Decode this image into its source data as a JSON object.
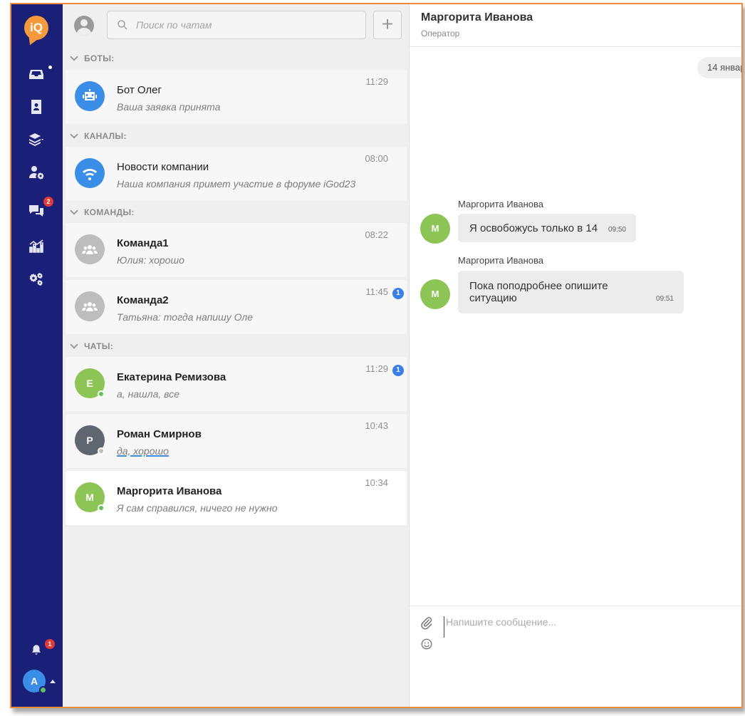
{
  "app": {
    "logo_text": "iQ"
  },
  "rail": {
    "messages_badge": "2",
    "notifications_badge": "1",
    "user_initial": "А"
  },
  "search": {
    "placeholder": "Поиск по чатам"
  },
  "add_label": "+",
  "sections": {
    "bots": "БОТЫ:",
    "channels": "КАНАЛЫ:",
    "teams": "КОМАНДЫ:",
    "chats": "ЧАТЫ:"
  },
  "chats": [
    {
      "name": "Бот Олег",
      "preview": "Ваша заявка принята",
      "time": "11:29",
      "avatar_icon": "robot-icon",
      "avatar_color": "#3a8ee8"
    },
    {
      "name": "Новости компании",
      "preview": "Наша компания примет участие в форуме iGod23",
      "time": "08:00",
      "avatar_icon": "wifi-icon",
      "avatar_color": "#3a8ee8"
    },
    {
      "name": "Команда1",
      "preview": "Юлия: хорошо",
      "time": "08:22",
      "avatar_icon": "team-icon",
      "avatar_color": "#bdbdbd"
    },
    {
      "name": "Команда2",
      "preview": "Татьяна: тогда напишу Оле",
      "time": "11:45",
      "unread": "1",
      "avatar_icon": "team-icon",
      "avatar_color": "#bdbdbd"
    },
    {
      "name": "Екатерина Ремизова",
      "preview": "а, нашла, все",
      "time": "11:29",
      "unread": "1",
      "initial": "Е",
      "avatar_color": "#8cc455",
      "status_color": "#5cc05c"
    },
    {
      "name": "Роман Смирнов",
      "preview": "да, хорошо",
      "time": "10:43",
      "initial": "Р",
      "avatar_color": "#5f6670",
      "status_color": "#bdbdbd"
    },
    {
      "name": "Маргорита Иванова",
      "preview": "Я сам справился, ничего не нужно",
      "time": "10:34",
      "initial": "М",
      "avatar_color": "#8cc455",
      "status_color": "#5cc05c"
    }
  ],
  "conversation": {
    "title": "Маргорита Иванова",
    "subtitle": "Оператор",
    "date_label": "14 январ",
    "messages": [
      {
        "author": "Маргорита Иванова",
        "initial": "М",
        "text": "Я освобожусь только в 14",
        "time": "09:50"
      },
      {
        "author": "Маргорита Иванова",
        "initial": "М",
        "text": "Пока поподробнее опишите ситуацию",
        "time": "09:51"
      }
    ],
    "composer_placeholder": "Напишите сообщение..."
  }
}
